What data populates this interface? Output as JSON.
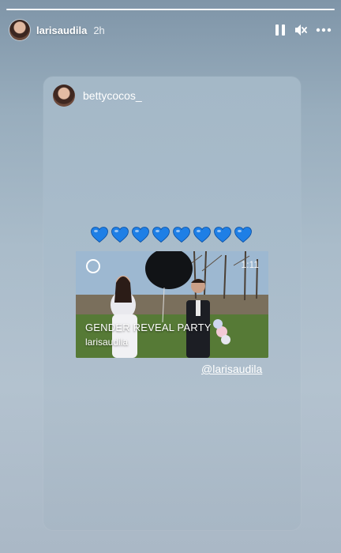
{
  "header": {
    "username": "larisaudila",
    "time": "2h"
  },
  "progress": {
    "segments": 1,
    "current": 1
  },
  "shared_post": {
    "username": "bettycocos_",
    "hearts_count": 8,
    "heart_color": "#1e7fe6",
    "video": {
      "title": "GENDER REVEAL PARTY",
      "username": "larisaudila",
      "duration": "1:11"
    }
  },
  "mention": "@larisaudila",
  "colors": {
    "text": "#ffffff"
  },
  "icons": [
    "pause-icon",
    "mute-icon",
    "more-icon",
    "heart-icon",
    "reel-icon"
  ]
}
